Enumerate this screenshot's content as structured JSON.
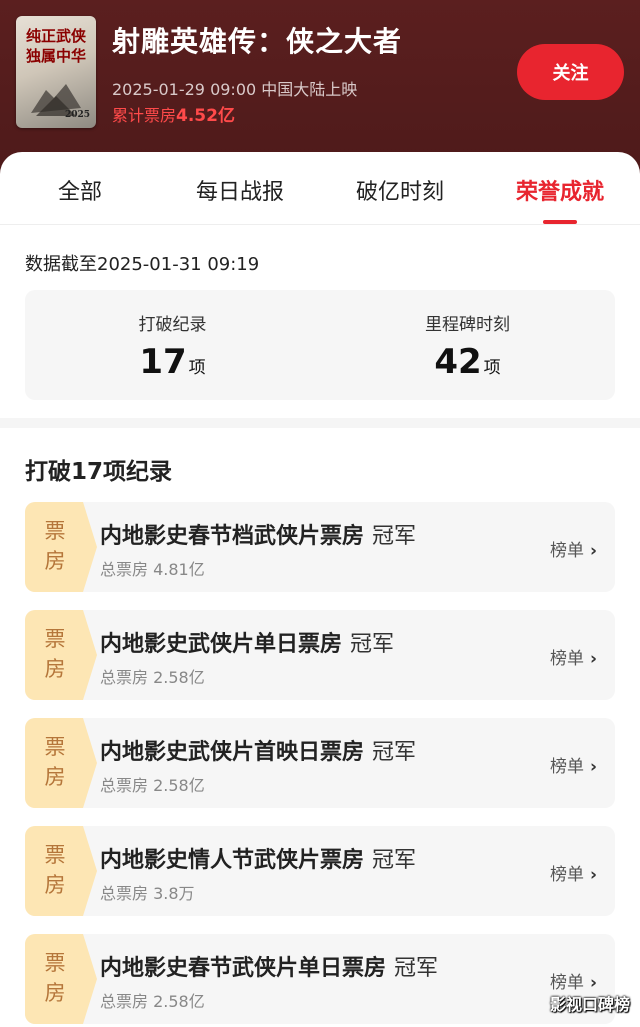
{
  "movie": {
    "poster_text": "纯正武侠 独属中华",
    "poster_year": "2025",
    "title": "射雕英雄传：侠之大者",
    "release": "2025-01-29 09:00 中国大陆上映",
    "boxoffice_label": "累计票房",
    "boxoffice_value": "4.52亿",
    "follow_label": "关注"
  },
  "tabs": [
    {
      "label": "全部"
    },
    {
      "label": "每日战报"
    },
    {
      "label": "破亿时刻"
    },
    {
      "label": "荣誉成就"
    }
  ],
  "active_tab": "荣誉成就",
  "as_of": "数据截至2025-01-31  09:19",
  "stats": [
    {
      "label": "打破纪录",
      "value": "17",
      "unit": "项"
    },
    {
      "label": "里程碑时刻",
      "value": "42",
      "unit": "项"
    }
  ],
  "section_title": "打破17项纪录",
  "records": [
    {
      "badge": "票房",
      "title": "内地影史春节档武侠片票房",
      "tag": "冠军",
      "sub": "总票房 4.81亿",
      "link": "榜单"
    },
    {
      "badge": "票房",
      "title": "内地影史武侠片单日票房",
      "tag": "冠军",
      "sub": "总票房 2.58亿",
      "link": "榜单"
    },
    {
      "badge": "票房",
      "title": "内地影史武侠片首映日票房",
      "tag": "冠军",
      "sub": "总票房 2.58亿",
      "link": "榜单"
    },
    {
      "badge": "票房",
      "title": "内地影史情人节武侠片票房",
      "tag": "冠军",
      "sub": "总票房 3.8万",
      "link": "榜单"
    },
    {
      "badge": "票房",
      "title": "内地影史春节武侠片单日票房",
      "tag": "冠军",
      "sub": "总票房 2.58亿",
      "link": "榜单"
    }
  ],
  "watermark": "影视口碑榜",
  "colors": {
    "accent": "#e8252f",
    "header_bg": "#5b1f1f",
    "badge_bg": "#fde6b4",
    "badge_text": "#b5763a"
  },
  "icons": {
    "chevron": "chevron-right-icon"
  }
}
